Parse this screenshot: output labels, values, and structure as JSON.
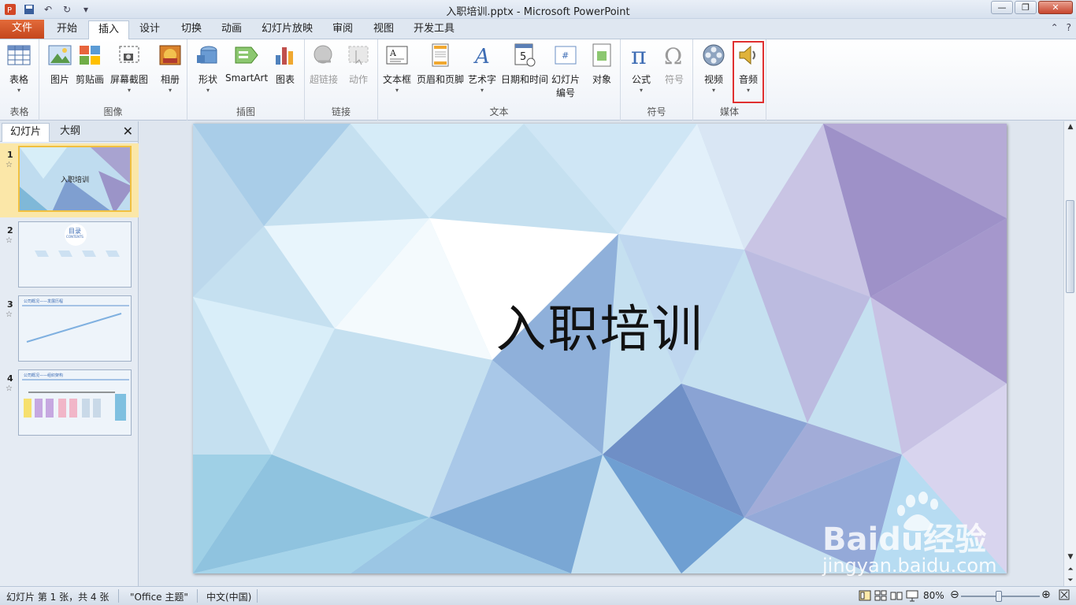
{
  "window": {
    "title": "入职培训.pptx - Microsoft PowerPoint"
  },
  "ribbon_tabs": [
    "文件",
    "开始",
    "插入",
    "设计",
    "切换",
    "动画",
    "幻灯片放映",
    "审阅",
    "视图",
    "开发工具"
  ],
  "active_tab": "插入",
  "groups": {
    "table": {
      "label": "表格",
      "buttons": [
        "表格"
      ]
    },
    "image": {
      "label": "图像",
      "buttons": [
        "图片",
        "剪贴画",
        "屏幕截图",
        "相册"
      ]
    },
    "illus": {
      "label": "插图",
      "buttons": [
        "形状",
        "SmartArt",
        "图表"
      ]
    },
    "link": {
      "label": "链接",
      "buttons": [
        "超链接",
        "动作"
      ]
    },
    "text": {
      "label": "文本",
      "buttons": [
        "文本框",
        "页眉和页脚",
        "艺术字",
        "日期和时间",
        "幻灯片",
        "编号",
        "对象"
      ]
    },
    "symbol": {
      "label": "符号",
      "buttons": [
        "公式",
        "符号"
      ]
    },
    "media": {
      "label": "媒体",
      "buttons": [
        "视频",
        "音频"
      ]
    }
  },
  "panel": {
    "tabs": [
      "幻灯片",
      "大纲"
    ],
    "close": "✕"
  },
  "slides": [
    {
      "num": "1",
      "title": "入职培训"
    },
    {
      "num": "2",
      "title": "目录",
      "subtitle": "CONTENTS"
    },
    {
      "num": "3",
      "title": "公司概况——发展历程"
    },
    {
      "num": "4",
      "title": "公司概况——组织架构"
    }
  ],
  "slide_main": {
    "title": "入职培训"
  },
  "status": {
    "slide_info": "幻灯片 第 1 张，共 4 张",
    "theme": "\"Office 主题\"",
    "lang": "中文(中国)",
    "zoom": "80%",
    "zoom_fraction": 0.48
  },
  "colors": {
    "accent": "#c4461d",
    "highlight": "#e03030"
  },
  "watermark": {
    "brand": "Baidu经验",
    "url": "jingyan.baidu.com"
  }
}
